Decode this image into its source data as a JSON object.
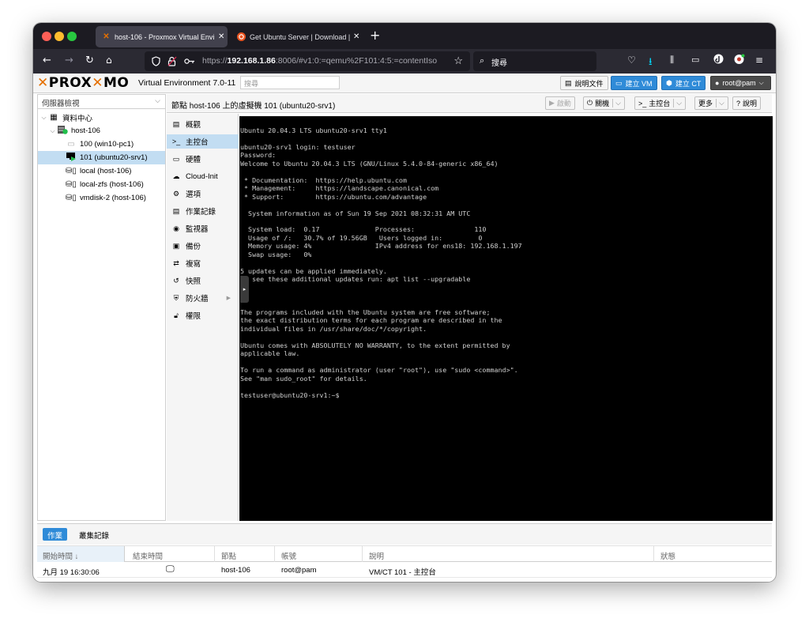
{
  "browser": {
    "tabs": [
      {
        "title": "host-106 - Proxmox Virtual Envi",
        "icon": "proxmox-x-icon",
        "active": true
      },
      {
        "title": "Get Ubuntu Server | Download |",
        "icon": "ubuntu-icon",
        "active": false
      }
    ],
    "url_prefix": "https://",
    "url_host": "192.168.1.86",
    "url_rest": ":8006/#v1:0:=qemu%2F101:4:5:=contentIso",
    "search_placeholder": "搜尋",
    "accent": "#e57000"
  },
  "header": {
    "logo_prox": "PROX",
    "logo_mo": "MO",
    "version": "Virtual Environment 7.0-11",
    "search_placeholder": "搜尋",
    "docs_label": "說明文件",
    "create_vm_label": "建立 VM",
    "create_ct_label": "建立 CT",
    "user_label": "root@pam"
  },
  "tree": {
    "view_select": "伺服器檢視",
    "items": [
      {
        "label": "資料中心",
        "icon": "datacenter-icon"
      },
      {
        "label": "host-106",
        "icon": "node-online-icon"
      },
      {
        "label": "100 (win10-pc1)",
        "icon": "vm-stopped-icon"
      },
      {
        "label": "101 (ubuntu20-srv1)",
        "icon": "vm-running-icon",
        "selected": true
      },
      {
        "label": "local (host-106)",
        "icon": "storage-icon"
      },
      {
        "label": "local-zfs (host-106)",
        "icon": "storage-icon"
      },
      {
        "label": "vmdisk-2 (host-106)",
        "icon": "storage-icon"
      }
    ]
  },
  "content": {
    "title": "節點 host-106 上的虛擬機 101 (ubuntu20-srv1)",
    "buttons": {
      "start": "啟動",
      "shutdown": "關機",
      "console": "主控台",
      "more": "更多",
      "help": "說明"
    }
  },
  "menu": {
    "items": [
      {
        "label": "概觀",
        "icon": "book-icon"
      },
      {
        "label": "主控台",
        "icon": "terminal-icon",
        "selected": true
      },
      {
        "label": "硬體",
        "icon": "monitor-icon"
      },
      {
        "label": "Cloud-Init",
        "icon": "cloud-icon"
      },
      {
        "label": "選項",
        "icon": "gear-icon"
      },
      {
        "label": "作業記錄",
        "icon": "list-icon"
      },
      {
        "label": "監視器",
        "icon": "eye-icon"
      },
      {
        "label": "備份",
        "icon": "floppy-icon"
      },
      {
        "label": "複寫",
        "icon": "retweet-icon"
      },
      {
        "label": "快照",
        "icon": "history-icon"
      },
      {
        "label": "防火牆",
        "icon": "shield-icon"
      },
      {
        "label": "權限",
        "icon": "unlock-icon"
      }
    ]
  },
  "console": {
    "lines": [
      "Ubuntu 20.04.3 LTS ubuntu20-srv1 tty1",
      "",
      "ubuntu20-srv1 login: testuser",
      "Password:",
      "Welcome to Ubuntu 20.04.3 LTS (GNU/Linux 5.4.0-84-generic x86_64)",
      "",
      " * Documentation:  https://help.ubuntu.com",
      " * Management:     https://landscape.canonical.com",
      " * Support:        https://ubuntu.com/advantage",
      "",
      "  System information as of Sun 19 Sep 2021 08:32:31 AM UTC",
      "",
      "  System load:  0.17              Processes:               110",
      "  Usage of /:   30.7% of 19.56GB   Users logged in:         0",
      "  Memory usage: 4%                IPv4 address for ens18: 192.168.1.197",
      "  Swap usage:   0%",
      "",
      "5 updates can be applied immediately.",
      "To see these additional updates run: apt list --upgradable",
      "",
      "",
      "",
      "The programs included with the Ubuntu system are free software;",
      "the exact distribution terms for each program are described in the",
      "individual files in /usr/share/doc/*/copyright.",
      "",
      "Ubuntu comes with ABSOLUTELY NO WARRANTY, to the extent permitted by",
      "applicable law.",
      "",
      "To run a command as administrator (user \"root\"), use \"sudo <command>\".",
      "See \"man sudo_root\" for details.",
      "",
      "testuser@ubuntu20-srv1:~$"
    ]
  },
  "bottom": {
    "tabs": {
      "tasks": "作業",
      "cluster_log": "叢集記錄"
    },
    "columns": {
      "start": "開始時間 ↓",
      "end": "結束時間",
      "node": "節點",
      "user": "帳號",
      "description": "說明",
      "status": "狀態"
    },
    "rows": [
      {
        "start": "九月 19 16:30:06",
        "end_icon": "monitor-icon",
        "node": "host-106",
        "user": "root@pam",
        "description": "VM/CT 101 - 主控台",
        "status": ""
      }
    ]
  }
}
